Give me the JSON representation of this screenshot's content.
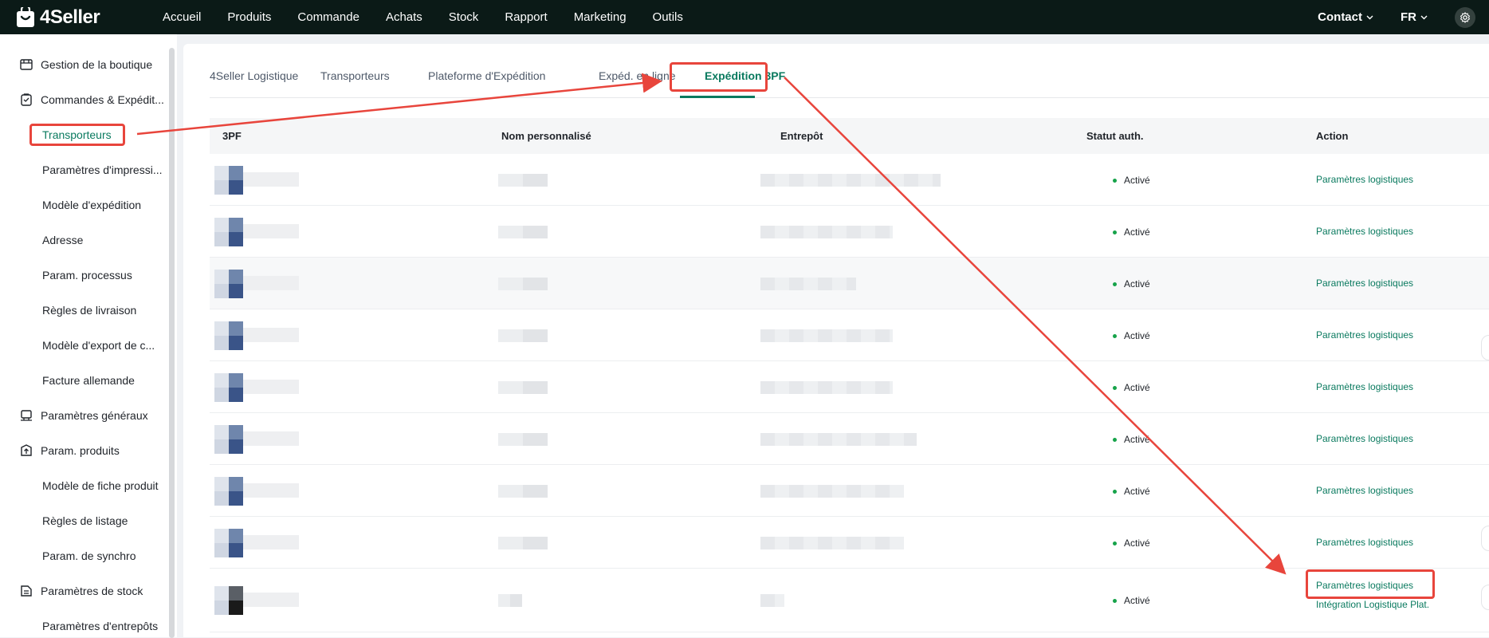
{
  "app": {
    "name": "4Seller"
  },
  "topnav": {
    "items": [
      "Accueil",
      "Produits",
      "Commande",
      "Achats",
      "Stock",
      "Rapport",
      "Marketing",
      "Outils"
    ]
  },
  "topright": {
    "contact": "Contact",
    "lang": "FR"
  },
  "sidebar": {
    "groups": [
      {
        "label": "Gestion de la boutique",
        "icon": "store-icon"
      },
      {
        "label": "Commandes & Expédit...",
        "icon": "clipboard-icon"
      },
      {
        "label": "Paramètres généraux",
        "icon": "printer-icon"
      },
      {
        "label": "Param. produits",
        "icon": "box-upload-icon"
      },
      {
        "label": "Paramètres de stock",
        "icon": "stock-icon"
      }
    ],
    "subs": [
      "Transporteurs",
      "Paramètres d'impressi...",
      "Modèle d'expédition",
      "Adresse",
      "Param. processus",
      "Règles de livraison",
      "Modèle d'export de c...",
      "Facture allemande",
      "Modèle de fiche produit",
      "Règles de listage",
      "Param. de synchro",
      "Paramètres d'entrepôts"
    ]
  },
  "tabs": [
    "4Seller Logistique",
    "Transporteurs",
    "Plateforme d'Expédition",
    "Expéd. en ligne",
    "Expédition 3PF"
  ],
  "table": {
    "headers": [
      "3PF",
      "Nom personnalisé",
      "Entrepôt",
      "Statut auth.",
      "Action"
    ],
    "rows": [
      {
        "status": "Activé",
        "action": "Paramètres logistiques"
      },
      {
        "status": "Activé",
        "action": "Paramètres logistiques"
      },
      {
        "status": "Activé",
        "action": "Paramètres logistiques"
      },
      {
        "status": "Activé",
        "action": "Paramètres logistiques"
      },
      {
        "status": "Activé",
        "action": "Paramètres logistiques"
      },
      {
        "status": "Activé",
        "action": "Paramètres logistiques"
      },
      {
        "status": "Activé",
        "action": "Paramètres logistiques"
      },
      {
        "status": "Activé",
        "action": "Paramètres logistiques"
      },
      {
        "status": "Activé",
        "action": "Paramètres logistiques",
        "action2": "Intégration Logistique Plat."
      }
    ]
  },
  "colors": {
    "accent": "#0a7a5f",
    "topbar": "#0b1a17",
    "annotation": "#e8453c",
    "status_dot": "#17a34a"
  }
}
